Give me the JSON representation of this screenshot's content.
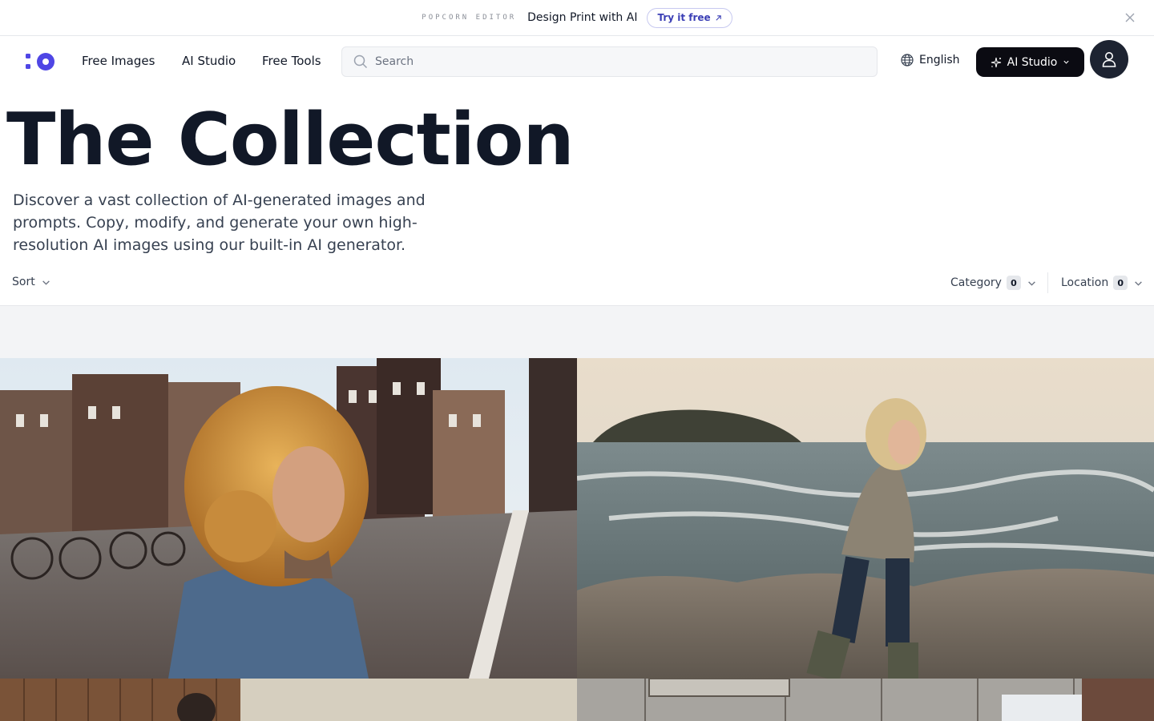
{
  "promo": {
    "brand": "POPCORN EDITOR",
    "text": "Design Print with AI",
    "cta": "Try it free"
  },
  "nav": {
    "links": [
      "Free Images",
      "AI Studio",
      "Free Tools"
    ],
    "search_placeholder": "Search",
    "language": "English",
    "studio_button": "AI Studio"
  },
  "hero": {
    "title": "The Collection",
    "description": "Discover a vast collection of AI-generated images and prompts. Copy, modify, and generate your own high-resolution AI images using our built-in AI generator."
  },
  "filters": {
    "sort_label": "Sort",
    "category": {
      "label": "Category",
      "count": "0"
    },
    "location": {
      "label": "Location",
      "count": "0"
    }
  },
  "icons": {
    "logo": "logo-icon",
    "search": "search-icon",
    "globe": "globe-icon",
    "sparkle": "sparkle-icon",
    "user": "user-icon",
    "close": "close-icon",
    "chevron": "chevron-down-icon",
    "external": "arrow-up-right-icon"
  },
  "colors": {
    "accent": "#4f46e5",
    "dark_button": "#0b0b12",
    "heading": "#111827"
  }
}
